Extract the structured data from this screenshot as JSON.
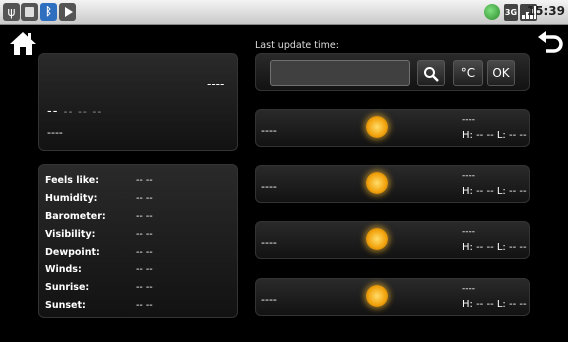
{
  "status_bar": {
    "usb_icon": "usb-debug-icon",
    "time": "15:39",
    "network_label": "3G"
  },
  "header": {
    "last_update_label": "Last update time:"
  },
  "current": {
    "location": "----",
    "temp_main": "--",
    "temp_secondary": "-- --  --",
    "condition": "----"
  },
  "details": [
    {
      "label": "Feels like:",
      "value": "-- --"
    },
    {
      "label": "Humidity:",
      "value": "-- --"
    },
    {
      "label": "Barometer:",
      "value": "-- --"
    },
    {
      "label": "Visibility:",
      "value": "-- --"
    },
    {
      "label": "Dewpoint:",
      "value": "-- --"
    },
    {
      "label": "Winds:",
      "value": "-- --"
    },
    {
      "label": "Sunrise:",
      "value": "-- --"
    },
    {
      "label": "Sunset:",
      "value": "-- --"
    }
  ],
  "search": {
    "input_value": "",
    "unit_label": "°C",
    "ok_label": "OK"
  },
  "forecast": [
    {
      "day": "----",
      "condition": "----",
      "hi_lo": "H: -- --  L: -- --",
      "icon": "sun-icon"
    },
    {
      "day": "----",
      "condition": "----",
      "hi_lo": "H: -- --  L: -- --",
      "icon": "sun-icon"
    },
    {
      "day": "----",
      "condition": "----",
      "hi_lo": "H: -- --  L: -- --",
      "icon": "sun-icon"
    },
    {
      "day": "----",
      "condition": "----",
      "hi_lo": "H: -- --  L: -- --",
      "icon": "sun-icon"
    }
  ],
  "colors": {
    "background": "#000000",
    "panel": "#1e1e1e",
    "sun": "#f3a50f"
  }
}
